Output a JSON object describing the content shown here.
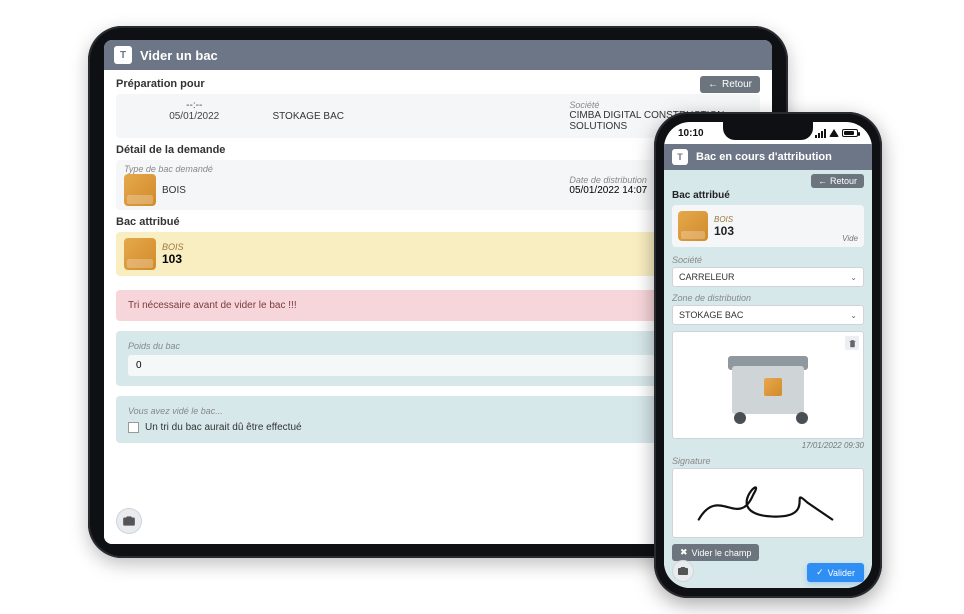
{
  "tablet": {
    "header_title": "Vider un bac",
    "btn_retour": "Retour",
    "prep": {
      "title": "Préparation pour",
      "time_label": "--:--",
      "date": "05/01/2022",
      "location": "STOKAGE BAC",
      "company_label": "Société",
      "company": "CIMBA DIGITAL CONSTRUCTION SOLUTIONS"
    },
    "detail": {
      "title": "Détail de la demande",
      "type_label": "Type de bac demandé",
      "type_value": "BOIS",
      "dist_label": "Date de distribution",
      "dist_value": "05/01/2022 14:07"
    },
    "assigned": {
      "title": "Bac attribué",
      "material": "BOIS",
      "number": "103"
    },
    "warning": "Tri nécessaire avant de vider le bac !!!",
    "weight": {
      "label": "Poids du bac",
      "value": "0"
    },
    "confirm": {
      "label": "Vous avez vidé le bac...",
      "checkbox": "Un tri du bac aurait dû être effectué"
    }
  },
  "phone": {
    "status_time": "10:10",
    "header_title": "Bac en cours d'attribution",
    "btn_retour": "Retour",
    "assigned": {
      "title": "Bac attribué",
      "material": "BOIS",
      "number": "103",
      "state": "Vide"
    },
    "company_label": "Société",
    "company_value": "CARRELEUR",
    "zone_label": "Zone de distribution",
    "zone_value": "STOKAGE BAC",
    "photo_date": "17/01/2022 09:30",
    "signature_label": "Signature",
    "btn_vider_champ": "Vider le champ",
    "btn_valider": "Valider"
  }
}
